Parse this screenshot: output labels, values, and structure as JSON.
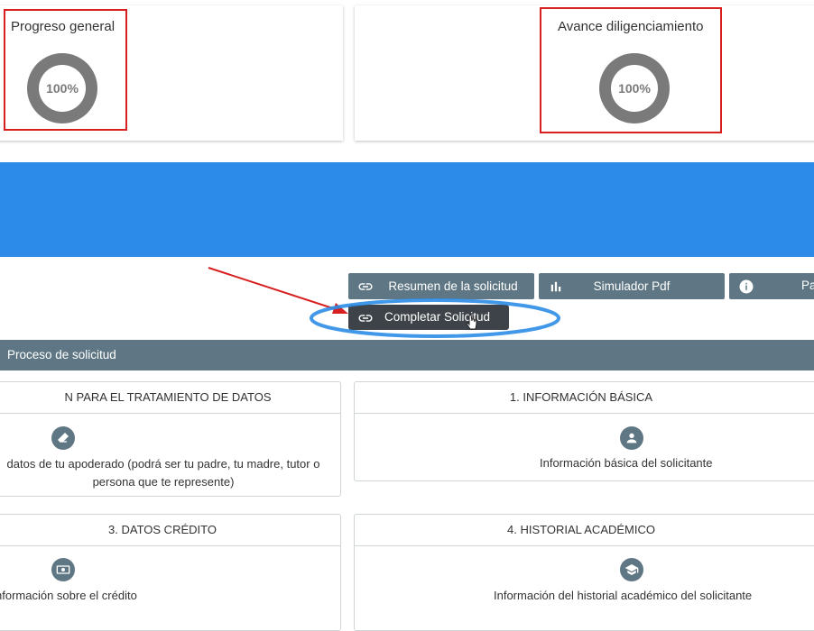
{
  "progress": {
    "general_title": "Progreso general",
    "general_value": "100%",
    "diligenciamiento_title": "Avance diligenciamiento",
    "diligenciamiento_value": "100%"
  },
  "actions": {
    "resumen_label": "Resumen de la solicitud",
    "simulador_label": "Simulador Pdf",
    "partial_label": "Pa",
    "tooltip_label": "Completar Solicitud"
  },
  "section": {
    "title": "Proceso de solicitud"
  },
  "steps": [
    {
      "title": "N PARA EL TRATAMIENTO DE DATOS",
      "desc_line1": "datos de tu apoderado (podrá ser tu padre, tu madre, tutor o",
      "desc_line2": "persona que te represente)",
      "icon": "eraser-icon"
    },
    {
      "title": "1. INFORMACIÓN BÁSICA",
      "desc_line1": "Información básica del solicitante",
      "icon": "person-icon"
    },
    {
      "title": "3. DATOS CRÉDITO",
      "desc_line1": "nformación sobre el crédito",
      "icon": "money-icon"
    },
    {
      "title": "4. HISTORIAL ACADÉMICO",
      "desc_line1": "Información del historial académico del solicitante",
      "icon": "graduation-cap-icon"
    }
  ],
  "colors": {
    "banner": "#2c8ae8",
    "slate": "#5f7784",
    "annotation_red": "#d81f1f",
    "annotation_blue": "#2d8de6",
    "donut": "#7a7a7a"
  }
}
